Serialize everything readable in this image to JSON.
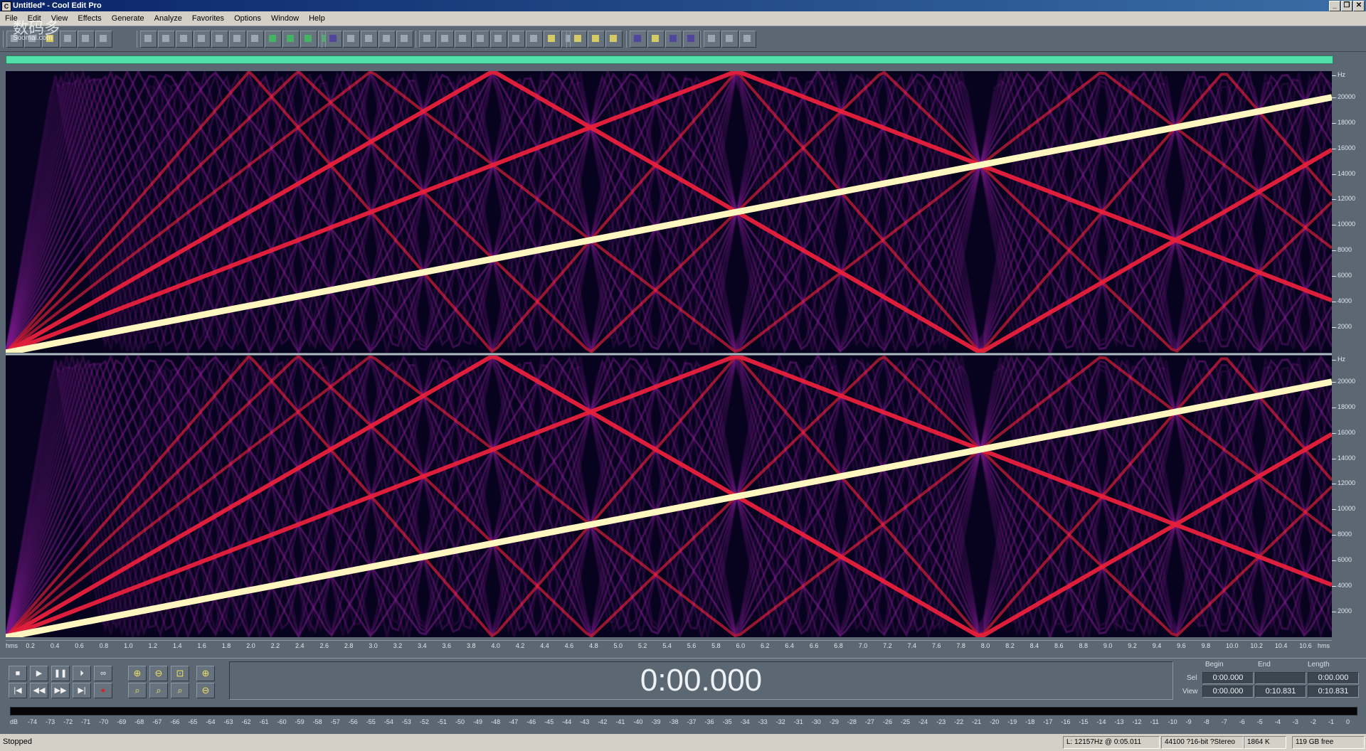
{
  "window": {
    "title": "Untitled* - Cool Edit Pro",
    "buttons": [
      "_",
      "❐",
      "✕"
    ]
  },
  "menu": [
    "File",
    "Edit",
    "View",
    "Effects",
    "Generate",
    "Analyze",
    "Favorites",
    "Options",
    "Window",
    "Help"
  ],
  "watermark": {
    "text": "数码多",
    "sub": "Soomal.com"
  },
  "spectrogram": {
    "freq_unit": "Hz",
    "freq_labels": [
      "20000",
      "18000",
      "16000",
      "14000",
      "12000",
      "10000",
      "8000",
      "6000",
      "4000",
      "2000"
    ],
    "freq_max_hz": 22050,
    "sweep_duration_s": 10.831,
    "colors": {
      "background": "#07031e",
      "fundamental": "#fff6c0",
      "harmonic_strong": "#e8203c",
      "harmonic_weak": "#7a1a8a"
    }
  },
  "time_ruler": {
    "start_label": "hms",
    "end_label": "hms",
    "ticks": [
      "0.2",
      "0.4",
      "0.6",
      "0.8",
      "1.0",
      "1.2",
      "1.4",
      "1.6",
      "1.8",
      "2.0",
      "2.2",
      "2.4",
      "2.6",
      "2.8",
      "3.0",
      "3.2",
      "3.4",
      "3.6",
      "3.8",
      "4.0",
      "4.2",
      "4.4",
      "4.6",
      "4.8",
      "5.0",
      "5.2",
      "5.4",
      "5.6",
      "5.8",
      "6.0",
      "6.2",
      "6.4",
      "6.6",
      "6.8",
      "7.0",
      "7.2",
      "7.4",
      "7.6",
      "7.8",
      "8.0",
      "8.2",
      "8.4",
      "8.6",
      "8.8",
      "9.0",
      "9.2",
      "9.4",
      "9.6",
      "9.8",
      "10.0",
      "10.2",
      "10.4",
      "10.6"
    ]
  },
  "transport": {
    "row1": [
      "■",
      "▶",
      "❚❚",
      "⏵",
      "∞"
    ],
    "row2": [
      "|◀",
      "◀◀",
      "▶▶",
      "▶|",
      "●"
    ]
  },
  "time_display": "0:00.000",
  "selection": {
    "headers": {
      "begin": "Begin",
      "end": "End",
      "length": "Length"
    },
    "sel": {
      "label": "Sel",
      "begin": "0:00.000",
      "end": "",
      "length": "0:00.000"
    },
    "view": {
      "label": "View",
      "begin": "0:00.000",
      "end": "0:10.831",
      "length": "0:10.831"
    }
  },
  "level_scale": [
    "dB",
    "-74",
    "-73",
    "-72",
    "-71",
    "-70",
    "-69",
    "-68",
    "-67",
    "-66",
    "-65",
    "-64",
    "-63",
    "-62",
    "-61",
    "-60",
    "-59",
    "-58",
    "-57",
    "-56",
    "-55",
    "-54",
    "-53",
    "-52",
    "-51",
    "-50",
    "-49",
    "-48",
    "-47",
    "-46",
    "-45",
    "-44",
    "-43",
    "-42",
    "-41",
    "-40",
    "-39",
    "-38",
    "-37",
    "-36",
    "-35",
    "-34",
    "-33",
    "-32",
    "-31",
    "-30",
    "-29",
    "-28",
    "-27",
    "-26",
    "-25",
    "-24",
    "-23",
    "-22",
    "-21",
    "-20",
    "-19",
    "-18",
    "-17",
    "-16",
    "-15",
    "-14",
    "-13",
    "-12",
    "-11",
    "-10",
    "-9",
    "-8",
    "-7",
    "-6",
    "-5",
    "-4",
    "-3",
    "-2",
    "-1",
    "0"
  ],
  "status": {
    "state": "Stopped",
    "cursor": "L: 12157Hz @  0:05.011",
    "format": "44100 ?16-bit ?Stereo",
    "size": "1864 K",
    "free": "119 GB free"
  }
}
